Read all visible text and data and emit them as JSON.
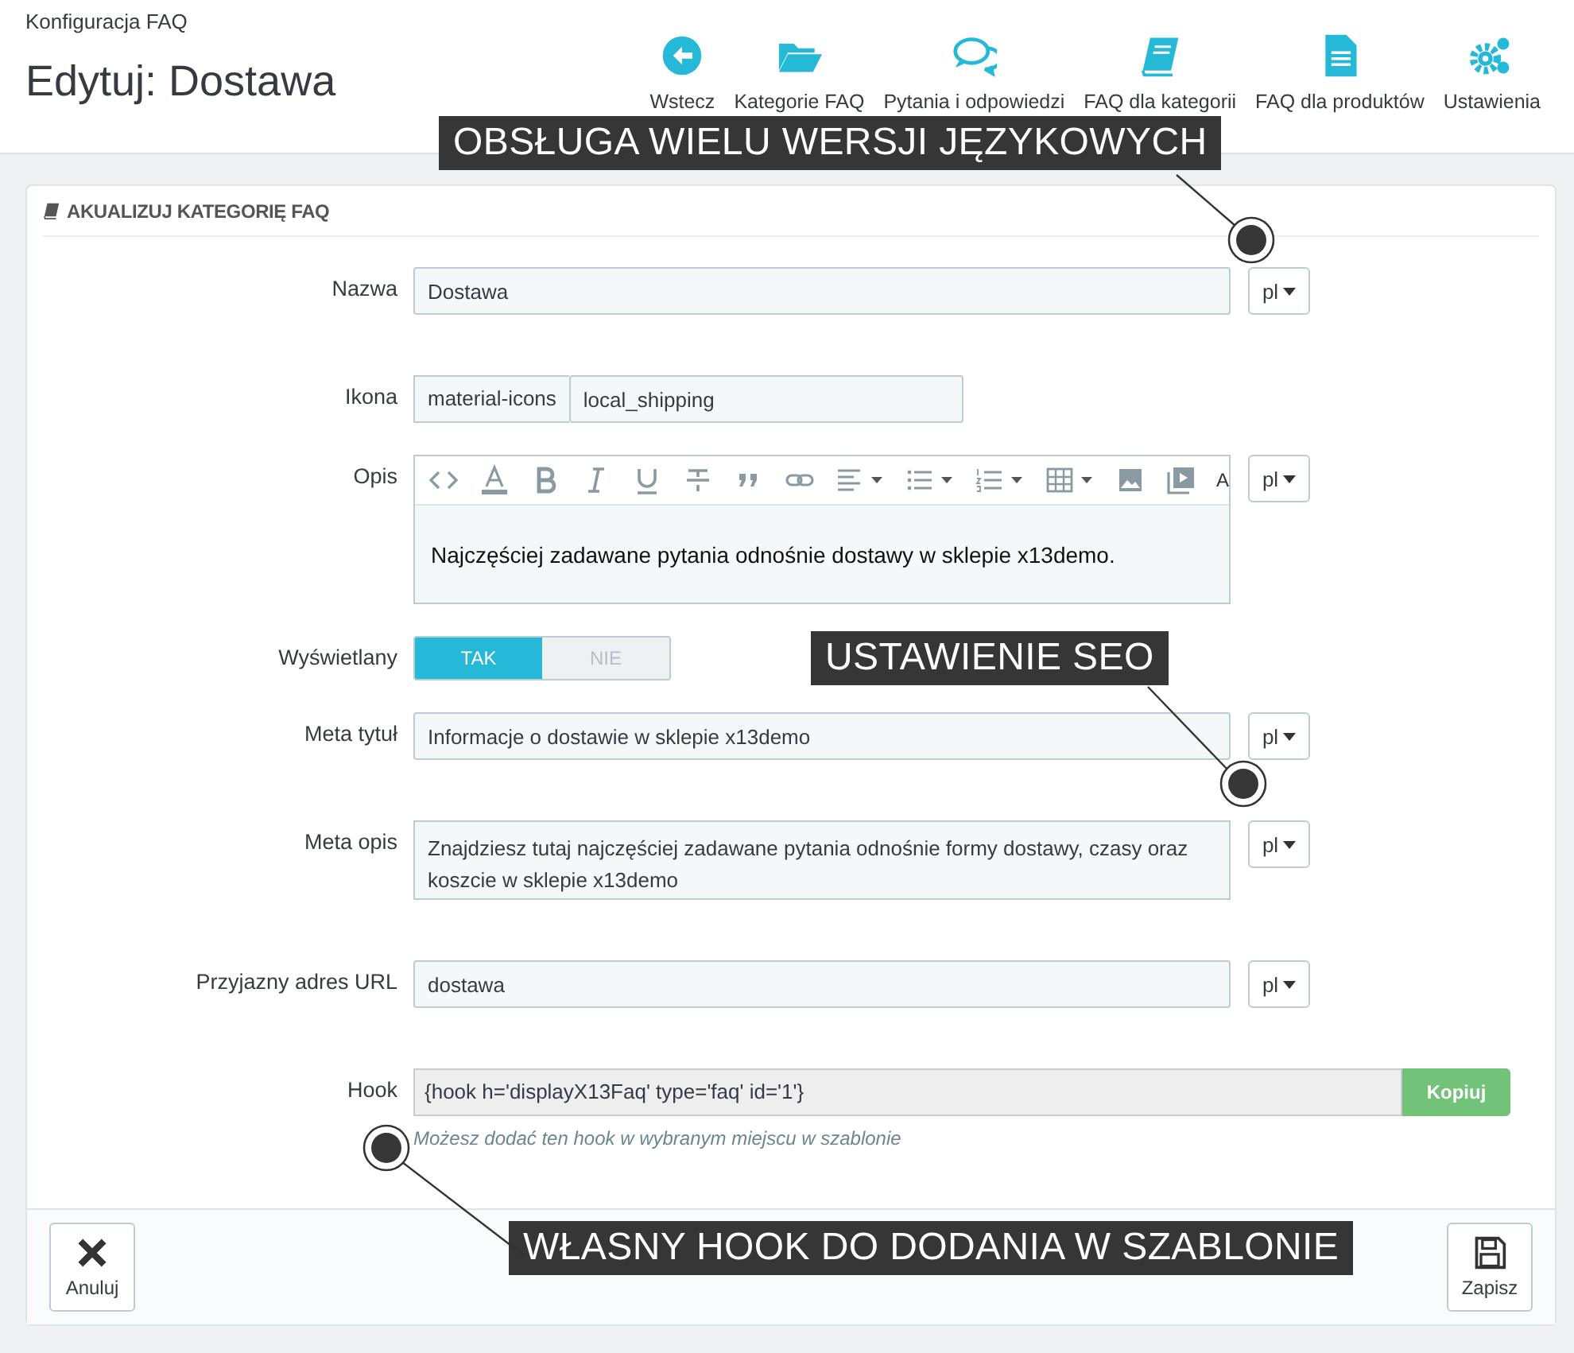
{
  "breadcrumb": "Konfiguracja FAQ",
  "title": "Edytuj: Dostawa",
  "toolbar": [
    {
      "label": "Wstecz"
    },
    {
      "label": "Kategorie FAQ"
    },
    {
      "label": "Pytania i odpowiedzi"
    },
    {
      "label": "FAQ dla kategorii"
    },
    {
      "label": "FAQ dla produktów"
    },
    {
      "label": "Ustawienia"
    }
  ],
  "panel": {
    "heading": "AKUALIZUJ KATEGORIĘ FAQ",
    "rows": [
      {
        "kind": "text",
        "label": "Nazwa",
        "value": "Dostawa",
        "lang": "pl"
      },
      {
        "kind": "addon",
        "label": "Ikona",
        "addon": "material-icons",
        "value": "local_shipping"
      },
      {
        "kind": "editor",
        "label": "Opis",
        "toolbar_tail": "A",
        "value": "Najczęściej zadawane pytania odnośnie dostawy w sklepie x13demo.",
        "lang": "pl"
      },
      {
        "kind": "toggle",
        "label": "Wyświetlany",
        "options": [
          {
            "label": "TAK",
            "selected": true
          },
          {
            "label": "NIE",
            "selected": false
          }
        ]
      },
      {
        "kind": "text",
        "label": "Meta tytuł",
        "value": "Informacje o dostawie w sklepie x13demo",
        "lang": "pl"
      },
      {
        "kind": "textarea",
        "label": "Meta opis",
        "value": "Znajdziesz tutaj najczęściej zadawane pytania odnośnie formy dostawy, czasy oraz koszcie w sklepie x13demo",
        "lang": "pl"
      },
      {
        "kind": "text",
        "label": "Przyjazny adres URL",
        "value": "dostawa",
        "lang": "pl"
      },
      {
        "kind": "hook",
        "label": "Hook",
        "value": "{hook h='displayX13Faq' type='faq' id='1'}",
        "button": "Kopiuj",
        "help": "Możesz dodać ten hook w wybranym miejscu w szablonie"
      }
    ],
    "cancel": "Anuluj",
    "save": "Zapisz"
  },
  "callouts": [
    {
      "text": "OBSŁUGA WIELU WERSJI JĘZYKOWYCH"
    },
    {
      "text": "USTAWIENIE SEO"
    },
    {
      "text": "WŁASNY HOOK DO DODANIA W SZABLONIE"
    }
  ]
}
